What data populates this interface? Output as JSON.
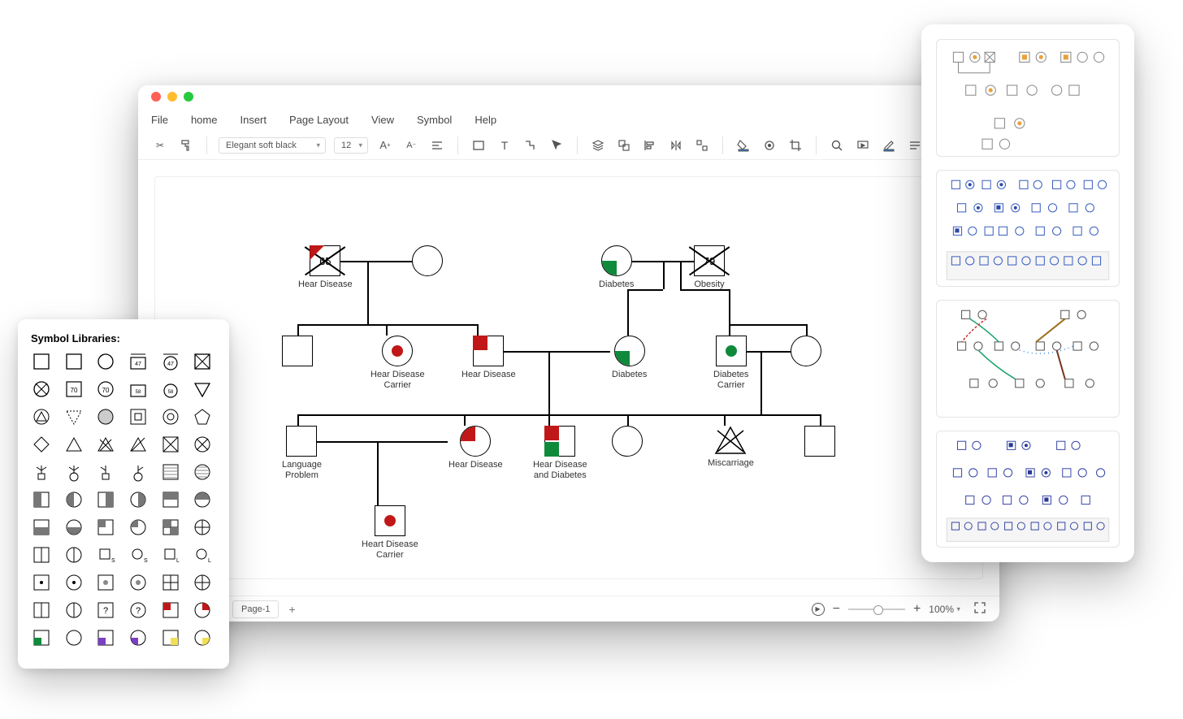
{
  "menu": [
    "File",
    "home",
    "Insert",
    "Page Layout",
    "View",
    "Symbol",
    "Help"
  ],
  "toolbar": {
    "font_name": "Elegant soft black",
    "font_size": "12"
  },
  "statusbar": {
    "page_tab": "Page-1",
    "zoom": "100%"
  },
  "symbol_panel_title": "Symbol Libraries:",
  "diagram": {
    "nodes": {
      "n1": {
        "label": "Hear Disease",
        "age": "65"
      },
      "n3": {
        "label": "Diabetes"
      },
      "n4": {
        "label": "Obesity",
        "age": "79"
      },
      "n5": {
        "label": ""
      },
      "n6": {
        "label": "Hear Disease\nCarrier"
      },
      "n7": {
        "label": "Hear Disease"
      },
      "n8": {
        "label": "Diabetes"
      },
      "n9": {
        "label": "Diabetes\nCarrier"
      },
      "n11": {
        "label": "Language\nProblem"
      },
      "n12": {
        "label": "Hear Disease"
      },
      "n13": {
        "label": "Hear Disease\nand Diabetes"
      },
      "n15": {
        "label": "Miscarriage"
      },
      "n17": {
        "label": "Heart Disease\nCarrier"
      }
    }
  }
}
